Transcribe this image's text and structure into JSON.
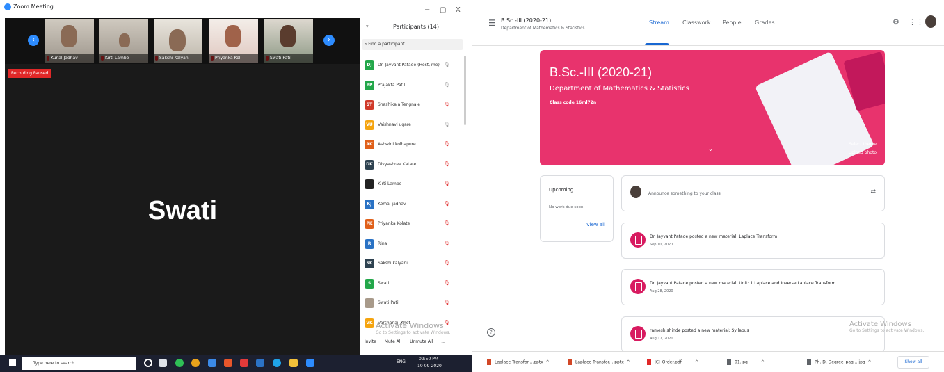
{
  "zoom": {
    "title": "Zoom Meeting",
    "window_controls": [
      "−",
      "▢",
      "X"
    ],
    "thumbnails": [
      "Kunal Jadhav",
      "Kirti Lambe",
      "Sakshi Kalyani",
      "Priyanka Kol",
      "Swati Patil"
    ],
    "recording": "Recording Paused",
    "active_speaker": "Swati",
    "participants_title": "Participants (14)",
    "search_placeholder": "Find a participant",
    "participants": [
      {
        "initials": "DJ",
        "name": "Dr. Jayvant Patade (Host, me)",
        "color": "#23a74a",
        "muted": false
      },
      {
        "initials": "PP",
        "name": "Prajakta Patil",
        "color": "#23a74a",
        "muted": false
      },
      {
        "initials": "ST",
        "name": "Shashikala Tengnale",
        "color": "#d03a2a",
        "muted": true
      },
      {
        "initials": "VU",
        "name": "Vaishnavi ugare",
        "color": "#f5a40f",
        "muted": false
      },
      {
        "initials": "AK",
        "name": "Ashwini kolhapure",
        "color": "#e0601a",
        "muted": true
      },
      {
        "initials": "DK",
        "name": "Divyashree Katare",
        "color": "#2e4250",
        "muted": true
      },
      {
        "initials": "",
        "name": "Kirti Lambe",
        "color": "#222222",
        "muted": true
      },
      {
        "initials": "KJ",
        "name": "Komal jadhav",
        "color": "#2a72c4",
        "muted": true
      },
      {
        "initials": "PK",
        "name": "Priyanka Kolate",
        "color": "#e0601a",
        "muted": true
      },
      {
        "initials": "R",
        "name": "Rina",
        "color": "#2a72c4",
        "muted": true
      },
      {
        "initials": "SK",
        "name": "Sakshi kalyani",
        "color": "#2e4250",
        "muted": true
      },
      {
        "initials": "S",
        "name": "Swati",
        "color": "#23a74a",
        "muted": true
      },
      {
        "initials": "",
        "name": "Swati Patil",
        "color": "#a89a8a",
        "muted": true
      },
      {
        "initials": "VK",
        "name": "Varshanaji Khot",
        "color": "#f5a40f",
        "muted": true
      }
    ],
    "footer_buttons": [
      "Invite",
      "Mute All",
      "Unmute All",
      "..."
    ],
    "activate_title": "Activate Windows",
    "activate_sub": "Go to Settings to activate Windows.",
    "taskbar_search": "Type here to search",
    "tray_lang": "ENG",
    "tray_time": "09:50 PM",
    "tray_date": "10-09-2020"
  },
  "classroom": {
    "class_name": "B.Sc.-III (2020-21)",
    "department": "Department of Mathematics & Statistics",
    "tabs": [
      "Stream",
      "Classwork",
      "People",
      "Grades"
    ],
    "banner_title": "B.Sc.-III (2020-21)",
    "banner_dept": "Department of Mathematics & Statistics",
    "class_code": "Class code 16ml72n",
    "select_theme": "Select theme",
    "upload_photo": "Upload photo",
    "upcoming_title": "Upcoming",
    "upcoming_text": "No work due soon",
    "view_all": "View all",
    "announce_placeholder": "Announce something to your class",
    "posts": [
      {
        "title": "Dr. Jayvant Patade posted a new material: Laplace Transform",
        "date": "Sep 10, 2020"
      },
      {
        "title": "Dr. Jayvant Patade posted a new material: Unit: 1 Laplace and Inverse Laplace Transform",
        "date": "Aug 28, 2020"
      },
      {
        "title": "ramesh shinde posted a new material: Syllabus",
        "date": "Aug 17, 2020"
      }
    ],
    "activate_title": "Activate Windows",
    "activate_sub": "Go to Settings to activate Windows.",
    "downloads": [
      "Laplace Transfor....pptx",
      "Laplace Transfor....pptx",
      "JCI_Order.pdf",
      "01.jpg",
      "Ph. D. Degree_pag....jpg"
    ],
    "show_all": "Show all"
  }
}
